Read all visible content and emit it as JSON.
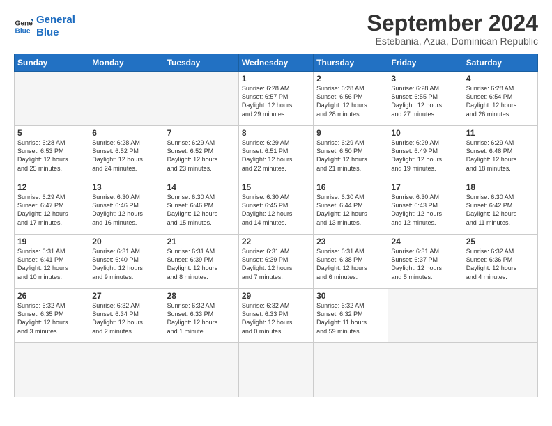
{
  "header": {
    "logo_line1": "General",
    "logo_line2": "Blue",
    "month": "September 2024",
    "location": "Estebania, Azua, Dominican Republic"
  },
  "weekdays": [
    "Sunday",
    "Monday",
    "Tuesday",
    "Wednesday",
    "Thursday",
    "Friday",
    "Saturday"
  ],
  "days": [
    {
      "num": "",
      "info": ""
    },
    {
      "num": "",
      "info": ""
    },
    {
      "num": "",
      "info": ""
    },
    {
      "num": "1",
      "info": "Sunrise: 6:28 AM\nSunset: 6:57 PM\nDaylight: 12 hours\nand 29 minutes."
    },
    {
      "num": "2",
      "info": "Sunrise: 6:28 AM\nSunset: 6:56 PM\nDaylight: 12 hours\nand 28 minutes."
    },
    {
      "num": "3",
      "info": "Sunrise: 6:28 AM\nSunset: 6:55 PM\nDaylight: 12 hours\nand 27 minutes."
    },
    {
      "num": "4",
      "info": "Sunrise: 6:28 AM\nSunset: 6:54 PM\nDaylight: 12 hours\nand 26 minutes."
    },
    {
      "num": "5",
      "info": "Sunrise: 6:28 AM\nSunset: 6:53 PM\nDaylight: 12 hours\nand 25 minutes."
    },
    {
      "num": "6",
      "info": "Sunrise: 6:28 AM\nSunset: 6:52 PM\nDaylight: 12 hours\nand 24 minutes."
    },
    {
      "num": "7",
      "info": "Sunrise: 6:29 AM\nSunset: 6:52 PM\nDaylight: 12 hours\nand 23 minutes."
    },
    {
      "num": "8",
      "info": "Sunrise: 6:29 AM\nSunset: 6:51 PM\nDaylight: 12 hours\nand 22 minutes."
    },
    {
      "num": "9",
      "info": "Sunrise: 6:29 AM\nSunset: 6:50 PM\nDaylight: 12 hours\nand 21 minutes."
    },
    {
      "num": "10",
      "info": "Sunrise: 6:29 AM\nSunset: 6:49 PM\nDaylight: 12 hours\nand 19 minutes."
    },
    {
      "num": "11",
      "info": "Sunrise: 6:29 AM\nSunset: 6:48 PM\nDaylight: 12 hours\nand 18 minutes."
    },
    {
      "num": "12",
      "info": "Sunrise: 6:29 AM\nSunset: 6:47 PM\nDaylight: 12 hours\nand 17 minutes."
    },
    {
      "num": "13",
      "info": "Sunrise: 6:30 AM\nSunset: 6:46 PM\nDaylight: 12 hours\nand 16 minutes."
    },
    {
      "num": "14",
      "info": "Sunrise: 6:30 AM\nSunset: 6:46 PM\nDaylight: 12 hours\nand 15 minutes."
    },
    {
      "num": "15",
      "info": "Sunrise: 6:30 AM\nSunset: 6:45 PM\nDaylight: 12 hours\nand 14 minutes."
    },
    {
      "num": "16",
      "info": "Sunrise: 6:30 AM\nSunset: 6:44 PM\nDaylight: 12 hours\nand 13 minutes."
    },
    {
      "num": "17",
      "info": "Sunrise: 6:30 AM\nSunset: 6:43 PM\nDaylight: 12 hours\nand 12 minutes."
    },
    {
      "num": "18",
      "info": "Sunrise: 6:30 AM\nSunset: 6:42 PM\nDaylight: 12 hours\nand 11 minutes."
    },
    {
      "num": "19",
      "info": "Sunrise: 6:31 AM\nSunset: 6:41 PM\nDaylight: 12 hours\nand 10 minutes."
    },
    {
      "num": "20",
      "info": "Sunrise: 6:31 AM\nSunset: 6:40 PM\nDaylight: 12 hours\nand 9 minutes."
    },
    {
      "num": "21",
      "info": "Sunrise: 6:31 AM\nSunset: 6:39 PM\nDaylight: 12 hours\nand 8 minutes."
    },
    {
      "num": "22",
      "info": "Sunrise: 6:31 AM\nSunset: 6:39 PM\nDaylight: 12 hours\nand 7 minutes."
    },
    {
      "num": "23",
      "info": "Sunrise: 6:31 AM\nSunset: 6:38 PM\nDaylight: 12 hours\nand 6 minutes."
    },
    {
      "num": "24",
      "info": "Sunrise: 6:31 AM\nSunset: 6:37 PM\nDaylight: 12 hours\nand 5 minutes."
    },
    {
      "num": "25",
      "info": "Sunrise: 6:32 AM\nSunset: 6:36 PM\nDaylight: 12 hours\nand 4 minutes."
    },
    {
      "num": "26",
      "info": "Sunrise: 6:32 AM\nSunset: 6:35 PM\nDaylight: 12 hours\nand 3 minutes."
    },
    {
      "num": "27",
      "info": "Sunrise: 6:32 AM\nSunset: 6:34 PM\nDaylight: 12 hours\nand 2 minutes."
    },
    {
      "num": "28",
      "info": "Sunrise: 6:32 AM\nSunset: 6:33 PM\nDaylight: 12 hours\nand 1 minute."
    },
    {
      "num": "29",
      "info": "Sunrise: 6:32 AM\nSunset: 6:33 PM\nDaylight: 12 hours\nand 0 minutes."
    },
    {
      "num": "30",
      "info": "Sunrise: 6:32 AM\nSunset: 6:32 PM\nDaylight: 11 hours\nand 59 minutes."
    },
    {
      "num": "",
      "info": ""
    },
    {
      "num": "",
      "info": ""
    },
    {
      "num": "",
      "info": ""
    },
    {
      "num": "",
      "info": ""
    },
    {
      "num": "",
      "info": ""
    }
  ]
}
